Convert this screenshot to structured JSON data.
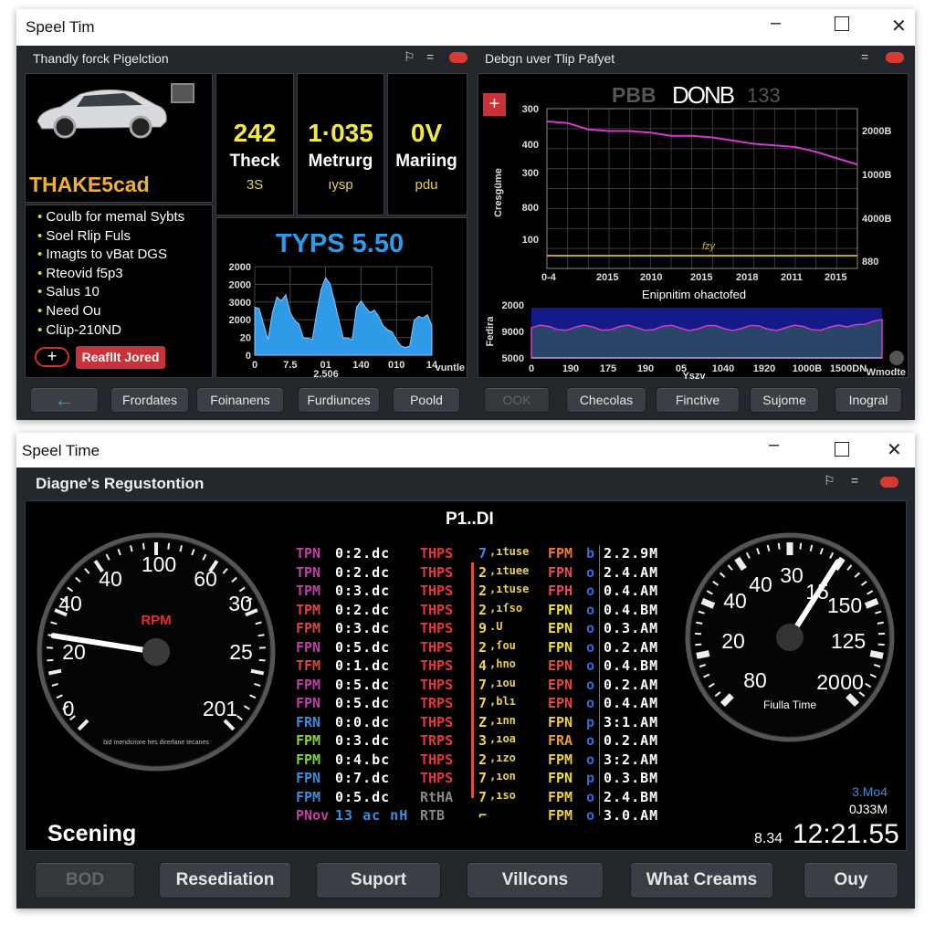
{
  "window1": {
    "title": "Speel Tim",
    "left_panel": {
      "title": "Thandly forck Pigelction",
      "car_label": "THAKE5cad",
      "stats": [
        {
          "value": "242",
          "label": "Theck",
          "unit": "3S"
        },
        {
          "value": "1·035",
          "label": "Metrurg",
          "unit": "ıysp"
        },
        {
          "value": "0V",
          "label": "Mariing",
          "unit": "pdu"
        }
      ],
      "list": [
        "Coulb for memal Sybts",
        "Soel Rlip Fuls",
        "Imagts to vBat DGS",
        "Rteovid f5p3",
        "Salus 10",
        "Need Ou",
        "Clüp-210ND"
      ],
      "add_label": "+",
      "action_label": "Reafllt Jored",
      "chart": {
        "title": "TYPS 5.50",
        "y_ticks": [
          "2000",
          "2000",
          "3000",
          "2000",
          "20",
          "0"
        ],
        "x_ticks": [
          "0",
          "7.5",
          "01",
          "140",
          "010",
          "14"
        ],
        "x_sub": "2.506",
        "x_unit": "vuntle",
        "values": [
          62,
          60,
          40,
          20,
          55,
          75,
          70,
          78,
          55,
          45,
          40,
          22,
          22,
          20,
          55,
          85,
          100,
          92,
          70,
          45,
          22,
          22,
          20,
          62,
          70,
          62,
          55,
          58,
          50,
          38,
          33,
          30,
          20,
          12,
          10,
          12,
          45,
          50,
          48,
          52,
          38
        ]
      }
    },
    "right_panel": {
      "title": "Debgn uver Tlip Pafyet",
      "header": [
        "PBB",
        "DONB",
        "133"
      ],
      "add_label": "+",
      "y_label": "Cresgüme",
      "y_ticks": [
        "300",
        "400",
        "300",
        "800",
        "100"
      ],
      "y2_ticks": [
        "2000B",
        "1000B",
        "4000B",
        "880"
      ],
      "x_ticks": [
        "0-4",
        "2015",
        "2010",
        "2015",
        "2018",
        "2011",
        "2015"
      ],
      "annotation": "fzy",
      "pink_values": [
        92,
        91,
        87,
        86,
        86,
        85,
        83,
        83,
        82,
        80,
        78,
        77,
        76,
        73,
        69,
        65
      ],
      "yellow_values": [
        8,
        8,
        8,
        8,
        8,
        8,
        8,
        8,
        8,
        8,
        8,
        8,
        8,
        8,
        8,
        8
      ],
      "sub_chart": {
        "title": "Enipnitim ohactofed",
        "y_label": "Fedira",
        "y_ticks": [
          "2000",
          "9000",
          "5000"
        ],
        "x_ticks": [
          "0",
          "190",
          "175",
          "190",
          "05",
          "1040",
          "1920",
          "1000B",
          "1500DN"
        ],
        "x_sub": "Yszy",
        "x_unit": "Wmodte"
      }
    },
    "buttons": [
      "←",
      "Frordates",
      "Foinanens",
      "Furdiunces",
      "Poold",
      "OOK",
      "Checolas",
      "Finctive",
      "Sujome",
      "Inogral"
    ]
  },
  "window2": {
    "title": "Speel Time",
    "panel_title": "Diagne's Regustontion",
    "center_title": "P1..DI",
    "rpm_gauge": {
      "label": "RPM",
      "ticks": [
        "0",
        "20",
        "40",
        "40",
        "100",
        "60",
        "30",
        "25",
        "201"
      ],
      "fine_print": "bid mendsnore hes direrfane tecanes",
      "needle_fraction": 0.2
    },
    "time_gauge": {
      "ticks": [
        "80",
        "20",
        "40",
        "40",
        "30",
        "15",
        "150",
        "125",
        "20",
        "00"
      ],
      "label": "Fiulla Time",
      "needle_fraction": 0.62
    },
    "rows": [
      [
        "TPN",
        "0:2.dc",
        "THPS",
        "7",
        ",ıtuse",
        "FPM",
        "b",
        "2.2.9M"
      ],
      [
        "TPN",
        "0:2.dc",
        "THPS",
        "2",
        ",ıtuee",
        "FPN",
        "o",
        "2.4.AM"
      ],
      [
        "TPM",
        "0:3.dc",
        "THPS",
        "2",
        ",ıtuse",
        "FPH",
        "o",
        "0.4.AM"
      ],
      [
        "TPM",
        "0:2.dc",
        "THPS",
        "2",
        ",ıſso",
        "FPN",
        "o",
        "0.4.BM"
      ],
      [
        "FPM",
        "0:3.dc",
        "THPS",
        "9",
        ".U",
        "EPN",
        "o",
        "0.3.AM"
      ],
      [
        "FPN",
        "0:5.dc",
        "THPS",
        "2",
        ",ſou",
        "FPN",
        "o",
        "0.2.AM"
      ],
      [
        "TFM",
        "0:1.dc",
        "THPS",
        "4",
        ",hno",
        "EPN",
        "o",
        "0.4.BM"
      ],
      [
        "FPM",
        "0:5.dc",
        "THPS",
        "7",
        ",ıou",
        "EPN",
        "o",
        "0.2.AM"
      ],
      [
        "FPN",
        "0:5.dc",
        "TRPS",
        "7",
        ",blı",
        "EPN",
        "o",
        "0.4.AM"
      ],
      [
        "FRN",
        "0:0.dc",
        "THPS",
        "Z",
        ",ınn",
        "FPN",
        "p",
        "3:1.AM"
      ],
      [
        "FPM",
        "0:3.dc",
        "TRPS",
        "3",
        ",ıoa",
        "FRA",
        "o",
        "0.2.AM"
      ],
      [
        "FPM",
        "0:4.bc",
        "THPS",
        "2",
        ",ızo",
        "FPM",
        "o",
        "3:2.AM"
      ],
      [
        "FPN",
        "0:7.dc",
        "THPS",
        "7",
        ",ıon",
        "FPN",
        "p",
        "0.3.BM"
      ],
      [
        "FPM",
        "0:5.dc",
        "RtHA",
        "7",
        ",ıso",
        "FPM",
        "o",
        "2.4.BM"
      ],
      [
        "PNov",
        "13 ac nH",
        "RTB",
        "⌐",
        "",
        "FPM",
        "o",
        "3.0.AM"
      ]
    ],
    "row_colors": {
      "c1": [
        "#c23fa8",
        "#c23fa8",
        "#c23fa8",
        "#e0443a",
        "#e0443a",
        "#c23fa8",
        "#e0443a",
        "#c23fa8",
        "#c23fa8",
        "#3a8de0",
        "#7fd63a",
        "#7fd63a",
        "#3a8de0",
        "#3a8de0",
        "#c23fa8"
      ],
      "c3": [
        "#f07a2a",
        "#e84a5a",
        "#e84a5a",
        "#f2e03a",
        "#f2e03a",
        "#f2e03a",
        "#e84a3a",
        "#e84a3a",
        "#e84a3a",
        "#f2d03a",
        "#f09a2a",
        "#f2d03a",
        "#f2e03a",
        "#f2d03a",
        "#f2d03a"
      ]
    },
    "status_label": "Scening",
    "readout": {
      "line1": "3.Mo4",
      "line2": "0J33M",
      "small": "8.34",
      "time": "12:21.55"
    },
    "buttons": [
      "BOD",
      "Resediation",
      "Suport",
      "Villcons",
      "What Creams",
      "Ouy"
    ]
  },
  "colors": {
    "accent_red": "#d63a32",
    "accent_blue": "#2f9be8",
    "yellow": "#f2e84a",
    "pink_line": "#d23ad0"
  }
}
